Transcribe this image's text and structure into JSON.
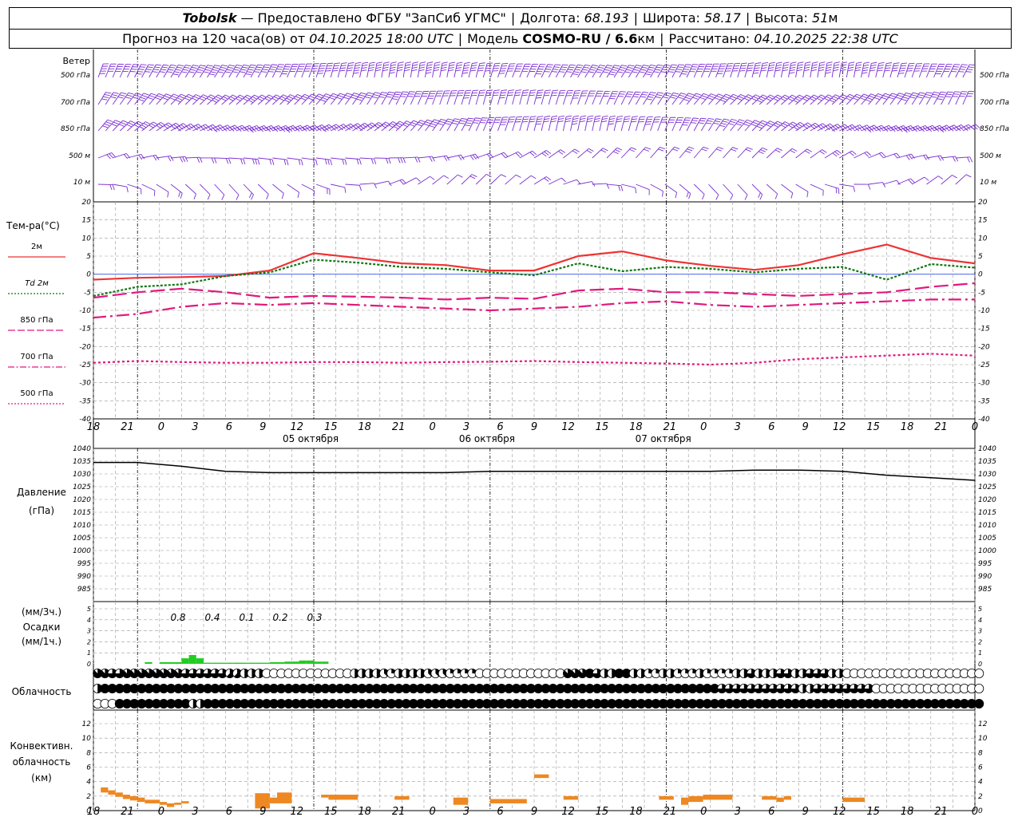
{
  "header": {
    "station": "Tobolsk",
    "provider": "— Предоставлено ФГБУ \"ЗапСиб УГМС\"",
    "lon_label": "Долгота:",
    "lon_value": "68.193",
    "lat_label": "Широта:",
    "lat_value": "58.17",
    "alt_label": "Высота:",
    "alt_value": "51",
    "alt_unit": "м",
    "forecast_label": "Прогноз на 120 часа(ов) от",
    "forecast_time": "04.10.2025 18:00 UTC",
    "model_label": "Модель",
    "model_name": "COSMO-RU / 6.6",
    "model_unit": "км",
    "calc_label": "Рассчитано:",
    "calc_time": "04.10.2025 22:38 UTC"
  },
  "colors": {
    "wind": "#7a2fd0",
    "t2m": "#ee3333",
    "td2m": "#117711",
    "t850": "#e0197d",
    "t700": "#e0197d",
    "t500": "#e0197d",
    "zero_line": "#3355ee",
    "pressure": "#000000",
    "precip": "#22cc22",
    "convective": "#ee8822",
    "grid": "#999999"
  },
  "time_axis": {
    "hour_ticks": [
      "18",
      "21",
      "0",
      "3",
      "6",
      "9",
      "12",
      "15",
      "18",
      "21",
      "0",
      "3",
      "6",
      "9",
      "12",
      "15",
      "18",
      "21",
      "0",
      "3",
      "6",
      "9",
      "12",
      "15",
      "18",
      "21",
      "0"
    ],
    "day_labels": [
      "05 октября",
      "06 октября",
      "07 октября"
    ]
  },
  "wind_panel": {
    "title": "Ветер",
    "levels": [
      "500 гПа",
      "700 гПа",
      "850 гПа",
      "500 м",
      "10 м"
    ]
  },
  "temp_panel": {
    "title": "Тем-ра(°C)",
    "legend": [
      {
        "key": "t2m",
        "label": "2м"
      },
      {
        "key": "td2m",
        "label": "Td  2м"
      },
      {
        "key": "t850",
        "label": "850 гПа"
      },
      {
        "key": "t700",
        "label": "700 гПа"
      },
      {
        "key": "t500",
        "label": "500 гПа"
      }
    ],
    "y_ticks": [
      "20",
      "15",
      "10",
      "5",
      "0",
      "-5",
      "-10",
      "-15",
      "-20",
      "-25",
      "-30",
      "-35",
      "-40"
    ]
  },
  "pressure_panel": {
    "title": "Давление",
    "unit": "(гПа)",
    "y_ticks": [
      "1040",
      "1035",
      "1030",
      "1025",
      "1020",
      "1015",
      "1010",
      "1005",
      "1000",
      "995",
      "990",
      "985"
    ]
  },
  "precip_panel": {
    "label_top": "(мм/3ч.)",
    "title": "Осадки",
    "label_bottom": "(мм/1ч.)",
    "y_ticks": [
      "5",
      "4",
      "3",
      "2",
      "1",
      "0"
    ],
    "totals": [
      "0.8",
      "0.4",
      "0.1",
      "0.2",
      "0.3"
    ]
  },
  "cloud_panel": {
    "title": "Облачность"
  },
  "conv_panel": {
    "title_line1": "Конвективн.",
    "title_line2": "облачность",
    "title_line3": "(км)",
    "y_ticks": [
      "12",
      "10",
      "8",
      "6",
      "4",
      "2",
      "0"
    ]
  },
  "chart_data": [
    {
      "type": "line",
      "panel": "temperature",
      "x_unit": "hours since 04.10.2025 18:00 UTC",
      "x": [
        0,
        6,
        12,
        18,
        24,
        30,
        36,
        42,
        48,
        54,
        60,
        66,
        72,
        78,
        84,
        90,
        96,
        102,
        108,
        114,
        120
      ],
      "ylim": [
        -40,
        20
      ],
      "series": [
        {
          "name": "2м",
          "values": [
            -1.5,
            -1,
            -0.8,
            -0.5,
            1,
            5.8,
            4.5,
            3,
            2.5,
            1,
            1,
            5,
            6.3,
            3.8,
            2.3,
            1.2,
            2.5,
            5.5,
            8.2,
            4.5,
            3
          ]
        },
        {
          "name": "Td  2м",
          "values": [
            -6,
            -3.5,
            -2.8,
            -0.5,
            0.5,
            4,
            3.2,
            2,
            1.5,
            0.5,
            -0.3,
            3,
            0.8,
            2,
            1.5,
            0.5,
            1.5,
            2,
            -1.5,
            2.8,
            1.8
          ]
        },
        {
          "name": "850 гПа",
          "values": [
            -6.5,
            -5,
            -4,
            -5,
            -6.5,
            -6,
            -6.2,
            -6.5,
            -7,
            -6.5,
            -6.8,
            -4.5,
            -4,
            -5,
            -5,
            -5.5,
            -6,
            -5.5,
            -5,
            -3.5,
            -2.5
          ]
        },
        {
          "name": "700 гПа",
          "values": [
            -12,
            -11,
            -9,
            -8,
            -8.5,
            -8,
            -8.5,
            -9,
            -9.5,
            -10,
            -9.5,
            -9,
            -8,
            -7.5,
            -8.5,
            -9,
            -8.5,
            -8,
            -7.5,
            -7,
            -7
          ]
        },
        {
          "name": "500 гПа",
          "values": [
            -24.5,
            -24,
            -24.3,
            -24.5,
            -24.5,
            -24.3,
            -24.3,
            -24.5,
            -24.3,
            -24.2,
            -24,
            -24.3,
            -24.5,
            -24.7,
            -25,
            -24.5,
            -23.5,
            -23,
            -22.5,
            -22,
            -22.5
          ]
        }
      ]
    },
    {
      "type": "line",
      "panel": "pressure",
      "x": [
        0,
        6,
        12,
        18,
        24,
        30,
        36,
        42,
        48,
        54,
        60,
        66,
        72,
        78,
        84,
        90,
        96,
        102,
        108,
        114,
        120
      ],
      "ylim": [
        985,
        1040
      ],
      "series": [
        {
          "name": "Давление",
          "values": [
            1034.5,
            1034.5,
            1033,
            1031,
            1030.5,
            1030.5,
            1030.5,
            1030.5,
            1030.5,
            1031,
            1031,
            1031,
            1031,
            1031,
            1031,
            1031.5,
            1031.5,
            1031,
            1029.5,
            1028.5,
            1027.5
          ]
        }
      ]
    },
    {
      "type": "bar",
      "panel": "precipitation",
      "x_unit": "hours since 04.10.2025 18:00 UTC",
      "hours": [
        6,
        8,
        9,
        10,
        11,
        12,
        13,
        14,
        15,
        16,
        17,
        18,
        19,
        20,
        21,
        22,
        23,
        24,
        25,
        26,
        27,
        28,
        29,
        30
      ],
      "values": [
        0.15,
        0.15,
        0.15,
        0.15,
        0.5,
        0.8,
        0.5,
        0.1,
        0.1,
        0.1,
        0.1,
        0.1,
        0.1,
        0.1,
        0.1,
        0.1,
        0.15,
        0.15,
        0.2,
        0.2,
        0.3,
        0.3,
        0.2,
        0.2
      ],
      "ylim": [
        0,
        5
      ]
    },
    {
      "type": "table",
      "panel": "cloud_cover",
      "description_rows": [
        "high",
        "middle",
        "low"
      ],
      "hourly_fraction_eighths": {
        "high": [
          7,
          7,
          6,
          6,
          7,
          7,
          7,
          7,
          7,
          7,
          7,
          7,
          6,
          6,
          6,
          6,
          6,
          6,
          5,
          5,
          4,
          4,
          4,
          0,
          0,
          0,
          0,
          0,
          0,
          0,
          0,
          0,
          0,
          0,
          0,
          4,
          4,
          4,
          4,
          3,
          2,
          4,
          4,
          4,
          4,
          3,
          3,
          3,
          2,
          2,
          2,
          2,
          0,
          0,
          0,
          0,
          0,
          0,
          0,
          0,
          0,
          0,
          0,
          0,
          7,
          7,
          7,
          8,
          6,
          4,
          4,
          8,
          8,
          4,
          4,
          2,
          2,
          4,
          4,
          2,
          2,
          2,
          4,
          2,
          2,
          2,
          2,
          4,
          4,
          6,
          4,
          4,
          4,
          6,
          6,
          4,
          4,
          6,
          6,
          6,
          4,
          4,
          0,
          0,
          0,
          0,
          0,
          0,
          0,
          0,
          0,
          0,
          0,
          0,
          0,
          0,
          0,
          0,
          0,
          0,
          0
        ],
        "middle": [
          4,
          8,
          8,
          8,
          8,
          8,
          8,
          8,
          8,
          8,
          8,
          8,
          8,
          8,
          8,
          8,
          8,
          8,
          8,
          8,
          8,
          8,
          8,
          8,
          8,
          8,
          8,
          8,
          8,
          8,
          8,
          8,
          8,
          8,
          8,
          8,
          8,
          8,
          8,
          8,
          8,
          8,
          8,
          8,
          8,
          8,
          8,
          8,
          8,
          8,
          8,
          8,
          8,
          8,
          8,
          8,
          8,
          8,
          8,
          8,
          8,
          8,
          8,
          8,
          8,
          8,
          8,
          8,
          8,
          8,
          8,
          8,
          8,
          8,
          8,
          8,
          8,
          8,
          8,
          8,
          8,
          8,
          8,
          8,
          8,
          6,
          6,
          6,
          6,
          6,
          6,
          6,
          6,
          6,
          6,
          6,
          4,
          4,
          6,
          6,
          6,
          6,
          6,
          6,
          6,
          6,
          0,
          0,
          0,
          0,
          0,
          0,
          0,
          0,
          0,
          0,
          0,
          0,
          0,
          0,
          0
        ],
        "low": [
          0,
          0,
          0,
          8,
          8,
          8,
          8,
          8,
          8,
          8,
          8,
          8,
          8,
          4,
          4,
          8,
          8,
          8,
          8,
          8,
          8,
          8,
          8,
          8,
          8,
          8,
          8,
          8,
          8,
          8,
          8,
          8,
          8,
          8,
          8,
          8,
          8,
          8,
          8,
          8,
          8,
          8,
          8,
          8,
          8,
          8,
          8,
          8,
          8,
          8,
          8,
          8,
          8,
          8,
          8,
          8,
          8,
          8,
          8,
          8,
          8,
          8,
          8,
          8,
          8,
          8,
          8,
          8,
          8,
          8,
          8,
          8,
          8,
          8,
          8,
          8,
          8,
          8,
          8,
          8,
          8,
          8,
          8,
          8,
          8,
          8,
          8,
          8,
          8,
          8,
          8,
          8,
          8,
          8,
          8,
          8,
          8,
          8,
          8,
          8,
          8,
          8,
          8,
          8,
          8,
          8,
          8,
          8,
          8,
          8,
          8,
          8,
          8,
          8,
          8,
          8,
          8,
          8,
          8,
          8,
          8
        ]
      }
    },
    {
      "type": "bar",
      "panel": "convective_cloud",
      "unit": "км",
      "ylim": [
        0,
        13
      ],
      "segments": [
        {
          "start": 1,
          "end": 2,
          "base": 2.5,
          "top": 3.2
        },
        {
          "start": 2,
          "end": 3,
          "base": 2.2,
          "top": 2.8
        },
        {
          "start": 3,
          "end": 4,
          "base": 1.9,
          "top": 2.5
        },
        {
          "start": 4,
          "end": 5,
          "base": 1.6,
          "top": 2.2
        },
        {
          "start": 5,
          "end": 6,
          "base": 1.4,
          "top": 2
        },
        {
          "start": 6,
          "end": 7,
          "base": 1.2,
          "top": 1.8
        },
        {
          "start": 7,
          "end": 9,
          "base": 1,
          "top": 1.5
        },
        {
          "start": 9,
          "end": 10,
          "base": 0.8,
          "top": 1.2
        },
        {
          "start": 10,
          "end": 11,
          "base": 0.5,
          "top": 1
        },
        {
          "start": 11,
          "end": 12,
          "base": 0.8,
          "top": 1.1
        },
        {
          "start": 12,
          "end": 13,
          "base": 1,
          "top": 1.3
        },
        {
          "start": 22,
          "end": 24,
          "base": 0.3,
          "top": 2.4
        },
        {
          "start": 24,
          "end": 25,
          "base": 1,
          "top": 1.8
        },
        {
          "start": 25,
          "end": 27,
          "base": 1,
          "top": 2.5
        },
        {
          "start": 31,
          "end": 32,
          "base": 1.8,
          "top": 2.2
        },
        {
          "start": 32,
          "end": 36,
          "base": 1.5,
          "top": 2.2
        },
        {
          "start": 41,
          "end": 43,
          "base": 1.5,
          "top": 2
        },
        {
          "start": 49,
          "end": 51,
          "base": 0.8,
          "top": 1.8
        },
        {
          "start": 54,
          "end": 59,
          "base": 1,
          "top": 1.6
        },
        {
          "start": 60,
          "end": 62,
          "base": 4.5,
          "top": 5
        },
        {
          "start": 64,
          "end": 66,
          "base": 1.5,
          "top": 2
        },
        {
          "start": 77,
          "end": 79,
          "base": 1.5,
          "top": 2
        },
        {
          "start": 80,
          "end": 81,
          "base": 0.8,
          "top": 1.8
        },
        {
          "start": 81,
          "end": 83,
          "base": 1.2,
          "top": 2
        },
        {
          "start": 83,
          "end": 87,
          "base": 1.5,
          "top": 2.2
        },
        {
          "start": 91,
          "end": 93,
          "base": 1.5,
          "top": 2
        },
        {
          "start": 93,
          "end": 94,
          "base": 1.2,
          "top": 1.8
        },
        {
          "start": 94,
          "end": 95,
          "base": 1.5,
          "top": 2
        },
        {
          "start": 102,
          "end": 105,
          "base": 1.2,
          "top": 1.8
        }
      ]
    }
  ]
}
